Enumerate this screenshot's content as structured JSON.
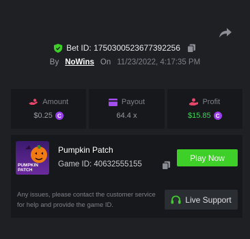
{
  "bet": {
    "id_label": "Bet ID: 1750300523677392256",
    "by_label": "By",
    "username": "NoWins",
    "on_label": "On",
    "date": "11/23/2022, 4:17:35 PM"
  },
  "stats": {
    "amount": {
      "label": "Amount",
      "value": "$0.25"
    },
    "payout": {
      "label": "Payout",
      "value": "64.4 x"
    },
    "profit": {
      "label": "Profit",
      "value": "$15.85"
    }
  },
  "game": {
    "title": "Pumpkin Patch",
    "id_label": "Game ID: 40632555155",
    "thumb_line1": "PUMPKIN",
    "thumb_line2": "PATCH",
    "play_label": "Play Now",
    "notice": "Any issues, please contact the customer service for help and provide the game ID.",
    "support_label": "Live Support"
  },
  "icons": {
    "share": "share-icon",
    "shield": "shield-check-icon",
    "copy": "copy-icon",
    "coin": "coin-icon",
    "headset": "headset-icon"
  },
  "colors": {
    "background": "#1e2024",
    "card": "#16181b",
    "accent_green": "#3fcf29",
    "profit_green": "#3fd35a",
    "coin_purple": "#9b3ef0",
    "amount_icon": "#e8456a",
    "payout_icon": "#a44df0",
    "profit_icon": "#e8456a"
  }
}
